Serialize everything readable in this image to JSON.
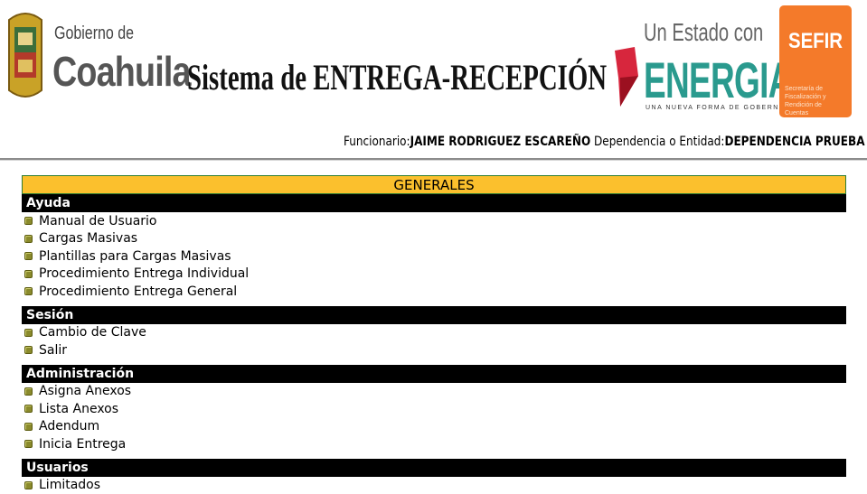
{
  "header": {
    "gobierno_small": "Gobierno de",
    "gobierno_big": "Coahuila",
    "system_title": "Sistema de ENTREGA-RECEPCIÓN",
    "estado_line": "Un Estado con",
    "energia": "ENERGIA",
    "energia_tagline": "UNA NUEVA FORMA DE GOBERNAR",
    "sefir_title": "SEFIR",
    "sefir_subtitle": "Secretaría de Fiscalización y Rendición de Cuentas",
    "colors": {
      "energia": "#2a9a8e",
      "sefir": "#f47a2a"
    }
  },
  "user": {
    "funcionario_label": "Funcionario:",
    "funcionario_value": "JAIME RODRIGUEZ ESCAREÑO",
    "dependencia_label": "Dependencia o Entidad:",
    "dependencia_value": "DEPENDENCIA PRUEBA"
  },
  "menu": {
    "title": "GENERALES",
    "colors": {
      "title_bg": "#fbc02d",
      "section_bg": "#000000",
      "bullet": "#8a8a2c"
    },
    "sections": [
      {
        "title": "Ayuda",
        "items": [
          "Manual de Usuario",
          "Cargas Masivas",
          "Plantillas para Cargas Masivas",
          "Procedimiento Entrega Individual",
          "Procedimiento Entrega General"
        ]
      },
      {
        "title": "Sesión",
        "items": [
          "Cambio de Clave",
          "Salir"
        ]
      },
      {
        "title": "Administración",
        "items": [
          "Asigna Anexos",
          "Lista Anexos",
          "Adendum",
          "Inicia Entrega"
        ]
      },
      {
        "title": "Usuarios",
        "items": [
          "Limitados"
        ]
      }
    ]
  }
}
